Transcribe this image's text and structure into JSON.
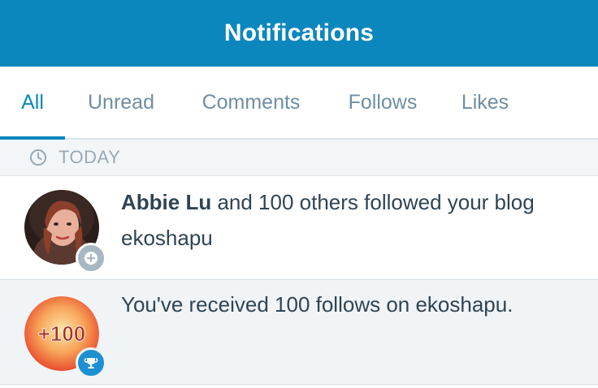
{
  "header": {
    "title": "Notifications",
    "background": "#0b87be"
  },
  "tabs": [
    {
      "label": "All",
      "active": true
    },
    {
      "label": "Unread",
      "active": false
    },
    {
      "label": "Comments",
      "active": false
    },
    {
      "label": "Follows",
      "active": false
    },
    {
      "label": "Likes",
      "active": false
    }
  ],
  "section": {
    "label": "TODAY",
    "icon": "clock-icon"
  },
  "notifications": [
    {
      "actor": "Abbie Lu",
      "text": " and 100 others followed your blog ekoshapu",
      "badge_icon": "follow-plus-icon"
    },
    {
      "text": "You've received 100 follows on ekoshapu.",
      "milestone_label": "+100",
      "badge_icon": "trophy-icon"
    }
  ],
  "colors": {
    "accent": "#0b87be",
    "muted": "#6f8ea3",
    "text": "#2f4454"
  }
}
